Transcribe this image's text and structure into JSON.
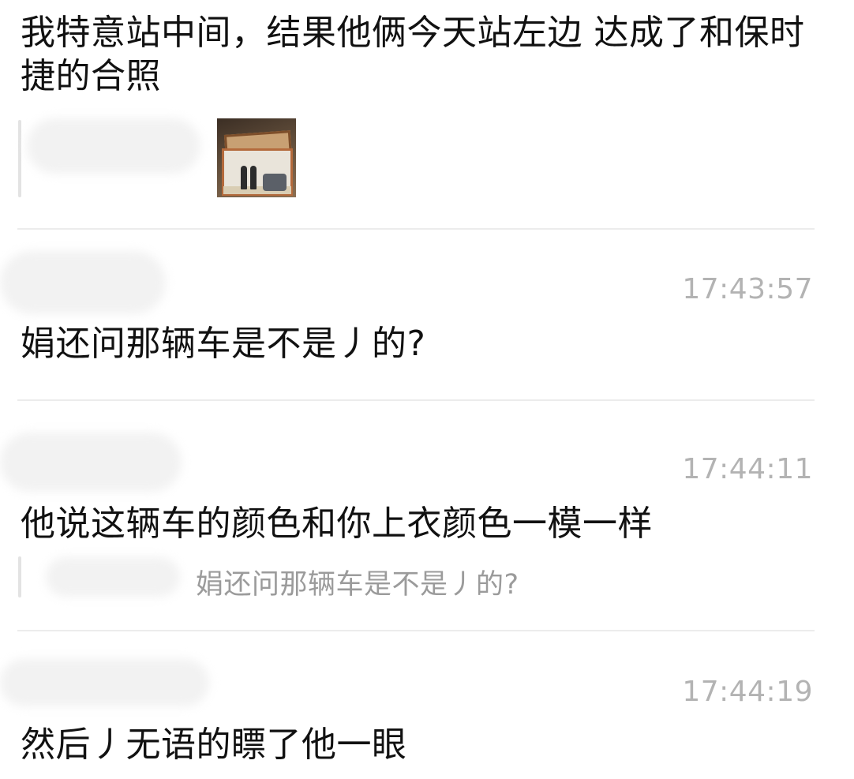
{
  "messages": [
    {
      "text": "我特意站中间，结果他俩今天站左边 达成了和保时捷的合照",
      "has_photo": true
    },
    {
      "timestamp": "17:43:57",
      "text": "娟还问那辆车是不是丿的?"
    },
    {
      "timestamp": "17:44:11",
      "text": "他说这辆车的颜色和你上衣颜色一模一样",
      "quote": "娟还问那辆车是不是丿的?"
    },
    {
      "timestamp": "17:44:19",
      "text": "然后丿无语的瞟了他一眼"
    }
  ],
  "colors": {
    "text": "#111111",
    "timestamp": "#b3b3b3",
    "quote": "#9b9b9b",
    "divider": "#ececec"
  }
}
